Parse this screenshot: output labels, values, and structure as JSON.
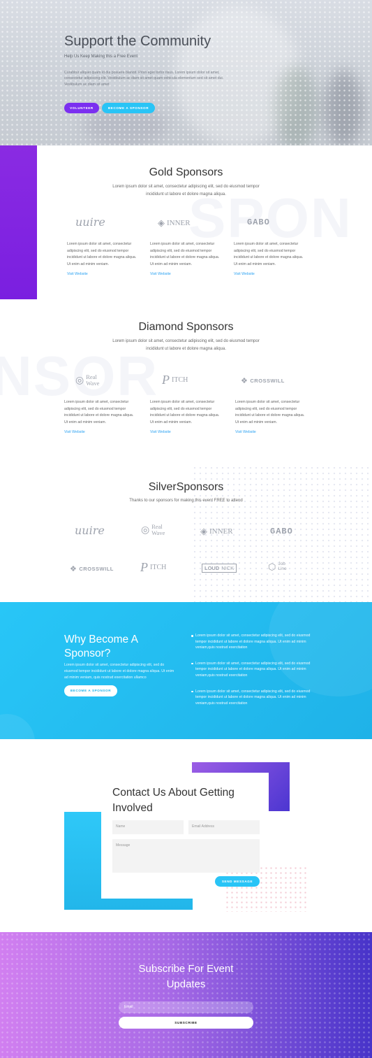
{
  "hero": {
    "title": "Support the Community",
    "subtitle": "Help Us Keep Making this a Free Event",
    "text": "Curabitur aliquet quam id dui posuere blandit. Proin eget tortor risus. Lorem ipsum dolor sit amet, consectetur adipiscing elit. Vestibulum ac diam sit amet quam vehicula elementum sed sit amet dui. Vestibulum ac diam sit amet",
    "volunteer_label": "VOLUNTEER",
    "sponsor_label": "BECOME A SPONSOR",
    "purple": "#7b2ff0",
    "cyan": "#29c4f6"
  },
  "gold": {
    "title": "Gold Sponsors",
    "description": "Lorem ipsum dolor sit amet, consectetur adipiscing elit, sed do eiusmod tempor incididunt ut labore et dolore magna aliqua.",
    "watermark": "SPON",
    "cards": [
      {
        "logo": "uuire",
        "text": "Lorem ipsum dolor sit amet, consectetur adipiscing elit, sed do eiusmod tempor incididunt ut labore et dolore magna aliqua. Ut enim ad minim veniam.",
        "link": "Visit Website"
      },
      {
        "logo": "INNER",
        "text": "Lorem ipsum dolor sit amet, consectetur adipiscing elit, sed do eiusmod tempor incididunt ut labore et dolore magna aliqua. Ut enim ad minim veniam.",
        "link": "Visit Website"
      },
      {
        "logo": "GABO",
        "text": "Lorem ipsum dolor sit amet, consectetur adipiscing elit, sed do eiusmod tempor incididunt ut labore et dolore magna aliqua. Ut enim ad minim veniam.",
        "link": "Visit Website"
      }
    ]
  },
  "diamond": {
    "title": "Diamond Sponsors",
    "description": "Lorem ipsum dolor sit amet, consectetur adipiscing elit, sed do eiusmod tempor incididunt ut labore et dolore magna aliqua.",
    "watermark": "NSOR",
    "cards": [
      {
        "logo_line1": "Real",
        "logo_line2": "Wave",
        "text": "Lorem ipsum dolor sit amet, consectetur adipiscing elit, sed do eiusmod tempor incididunt ut labore et dolore magna aliqua. Ut enim ad minim veniam.",
        "link": "Visit Website"
      },
      {
        "logo": "ITCH",
        "text": "Lorem ipsum dolor sit amet, consectetur adipiscing elit, sed do eiusmod tempor incididunt ut labore et dolore magna aliqua. Ut enim ad minim veniam.",
        "link": "Visit Website"
      },
      {
        "logo": "CROSSWILL",
        "text": "Lorem ipsum dolor sit amet, consectetur adipiscing elit, sed do eiusmod tempor incididunt ut labore et dolore magna aliqua. Ut enim ad minim veniam.",
        "link": "Visit Website"
      }
    ]
  },
  "silver": {
    "title": "SilverSponsors",
    "description": "Thanks to our sponsors for making this event FREE to attend",
    "logos": {
      "uuire": "uuire",
      "realwave1": "Real",
      "realwave2": "Wave",
      "inner": "INNER",
      "gabo": "GABO",
      "crosswill": "CROSSWILL",
      "pitch": "ITCH",
      "loud": "LOUD",
      "nick": "NICK",
      "job": "Job",
      "line": "Line"
    }
  },
  "why": {
    "title": "Why Become A Sponsor?",
    "text": "Lorem ipsum dolor sit amet, consectetur adipiscing elit, sed do eiusmod tempor incididunt ut labore et dolore magna aliqua. Ut enim ad minim veniam, quis nostrud exercitation ullamco",
    "button": "BECOME A SPONSOR",
    "bullets": [
      "Lorem ipsum dolor sit amet, consectetur adipiscing elit, sed do eiusmod tempor incididunt ut labore et dolore magna aliqua. Ut enim ad minim veniam,quis nostrud exercitation",
      "Lorem ipsum dolor sit amet, consectetur adipiscing elit, sed do eiusmod tempor incididunt ut labore et dolore magna aliqua. Ut enim ad minim veniam,quis nostrud exercitation",
      "Lorem ipsum dolor sit amet, consectetur adipiscing elit, sed do eiusmod tempor incididunt ut labore et dolore magna aliqua. Ut enim ad minim veniam,quis nostrud exercitation"
    ]
  },
  "contact": {
    "title": "Contact Us About Getting Involved",
    "name_placeholder": "Name",
    "email_placeholder": "Email Address",
    "message_placeholder": "Message",
    "send_label": "SEND MESSAGE"
  },
  "subscribe": {
    "title": "Subscribe For Event Updates",
    "email_placeholder": "Email",
    "button": "SUBSCRIBE"
  }
}
